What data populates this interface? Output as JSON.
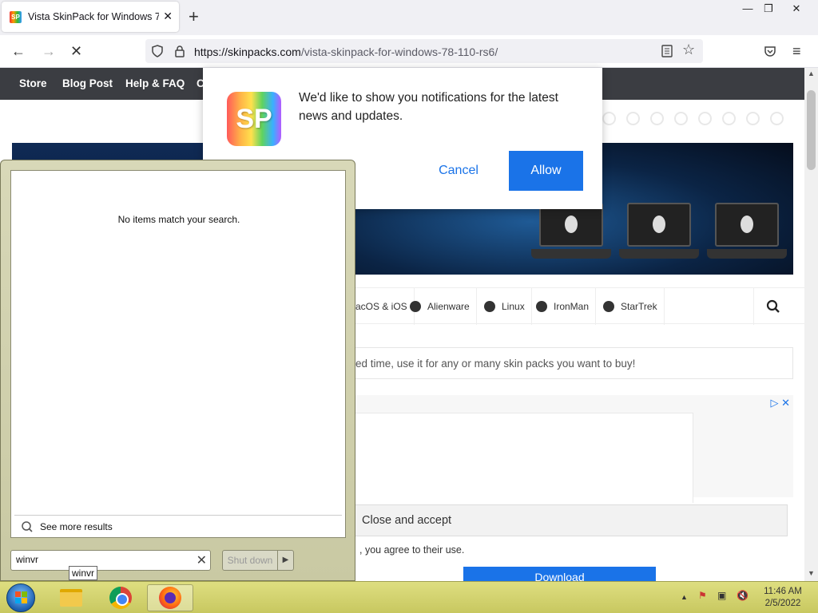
{
  "browser": {
    "tab_title": "Vista SkinPack for Windows 7\\8",
    "url_domain": "https://skinpacks.com",
    "url_path": "/vista-skinpack-for-windows-78-110-rs6/"
  },
  "site_nav": [
    "Store",
    "Blog Post",
    "Help & FAQ",
    "C"
  ],
  "categories": [
    "acOS & iOS",
    "Alienware",
    "Linux",
    "IronMan",
    "StarTrek"
  ],
  "promo_text": "ed time, use it for any or many skin packs you want to buy!",
  "cookie": {
    "button": "Close and accept",
    "text": ", you agree to their use."
  },
  "download_label": "Download",
  "notification": {
    "logo_text": "SP",
    "message": "We'd like to show you notifications for the latest news and updates.",
    "cancel": "Cancel",
    "allow": "Allow"
  },
  "start_menu": {
    "no_results": "No items match your search.",
    "see_more": "See more results",
    "search_value": "winvr",
    "shutdown": "Shut down",
    "tooltip": "winvr"
  },
  "clock": {
    "time": "11:46 AM",
    "date": "2/5/2022"
  },
  "colors": {
    "accent": "#1a73e8",
    "sitenav": "#3b3d42",
    "taskbar": "#dede80"
  }
}
